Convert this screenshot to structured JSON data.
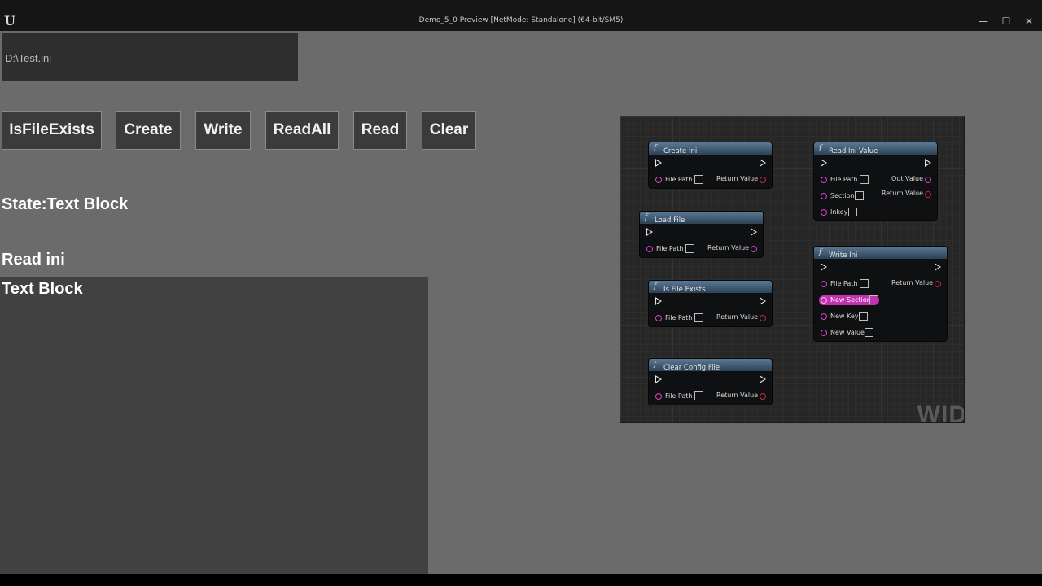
{
  "window": {
    "logo": "U",
    "title": "Demo_5_0 Preview [NetMode: Standalone]  (64-bit/SM5)",
    "controls": {
      "minimize": "—",
      "maximize": "☐",
      "close": "✕"
    }
  },
  "main": {
    "file_path_value": "D:\\Test.ini",
    "buttons": {
      "is_file_exists": "IsFileExists",
      "create": "Create",
      "write": "Write",
      "read_all": "ReadAll",
      "read": "Read",
      "clear": "Clear"
    },
    "state_label": "State:Text Block",
    "read_ini_label": "Read ini",
    "output_text": "Text Block"
  },
  "blueprint": {
    "watermark": "WID",
    "nodes": {
      "create_ini": {
        "title": "Create Ini",
        "file_path": "File Path",
        "return_value": "Return Value"
      },
      "load_file": {
        "title": "Load File",
        "file_path": "File Path",
        "return_value": "Return Value"
      },
      "is_file_exists": {
        "title": "Is File Exists",
        "file_path": "File Path",
        "return_value": "Return Value"
      },
      "clear_config_file": {
        "title": "Clear Config File",
        "file_path": "File Path",
        "return_value": "Return Value"
      },
      "read_ini_value": {
        "title": "Read Ini Value",
        "file_path": "File Path",
        "section": "Section",
        "inkey": "Inkey",
        "out_value": "Out Value",
        "return_value": "Return Value"
      },
      "write_ini": {
        "title": "Write Ini",
        "file_path": "File Path",
        "new_section": "New Section",
        "new_key": "New Key",
        "new_value": "New Value",
        "return_value": "Return Value"
      }
    },
    "function_icon": "f"
  }
}
